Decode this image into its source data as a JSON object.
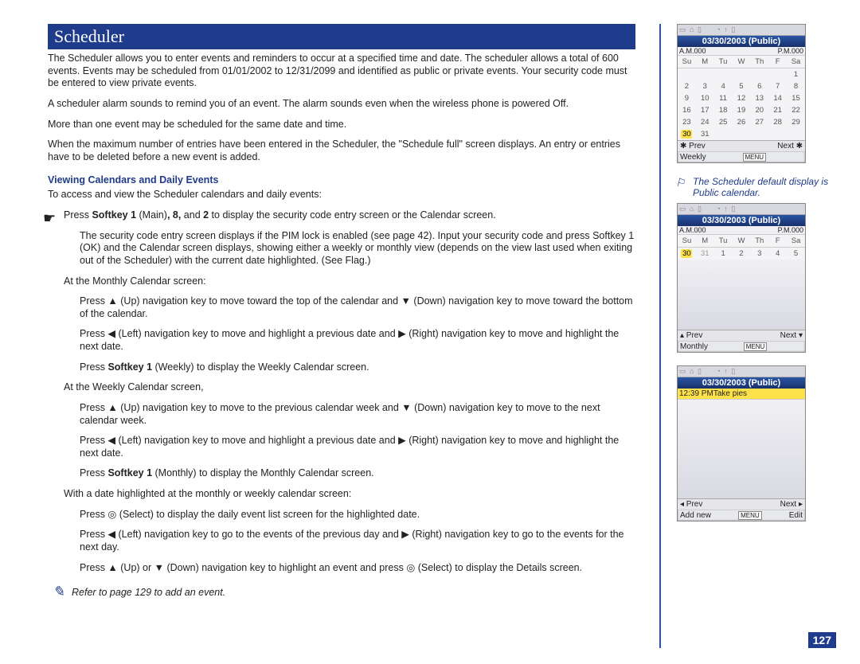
{
  "page_number": "127",
  "title": "Scheduler",
  "intro": [
    "The Scheduler allows you to enter events and reminders to occur at a specified time and date. The scheduler allows a total of 600 events. Events may be scheduled from 01/01/2002 to 12/31/2099 and identified as public or private events. Your security code must be entered to view private events.",
    "A scheduler alarm sounds to remind you of an event. The alarm sounds even when the wireless phone is powered Off.",
    "More than one event may be scheduled for the same date and time.",
    "When the maximum number of entries have been entered in the Scheduler, the \"Schedule full\" screen displays. An entry or entries have to be deleted before a new event is added."
  ],
  "subhead": "Viewing Calendars and Daily Events",
  "subhead_intro": "To access and view the Scheduler calendars and daily events:",
  "step1_a": "Press ",
  "step1_b": "Softkey 1",
  "step1_c": " (Main)",
  "step1_d": ", 8,",
  "step1_e": " and ",
  "step1_f": "2",
  "step1_g": " to display the security code entry screen or the Calendar screen.",
  "step1_sub": "The security code entry screen displays if the PIM lock is enabled (see page 42). Input your security code and press Softkey 1 (OK) and the Calendar screen displays, showing either a weekly or monthly view (depends on the view last used when exiting out of the Scheduler) with the current date highlighted. (See Flag.)",
  "monthly_head": "At the Monthly Calendar screen:",
  "monthly_1": "Press ▲ (Up) navigation key to move toward the top of the calendar and ▼ (Down) navigation key to move toward the bottom of the calendar.",
  "monthly_2": "Press ◀ (Left) navigation key to move and highlight a previous date and ▶ (Right) navigation key to move and highlight the next date.",
  "monthly_3_a": "Press ",
  "monthly_3_b": "Softkey 1",
  "monthly_3_c": " (Weekly) to display the Weekly Calendar screen.",
  "weekly_head": "At the Weekly Calendar screen,",
  "weekly_1": "Press ▲ (Up) navigation key to move to the previous calendar week and ▼ (Down) navigation key to move to the next calendar week.",
  "weekly_2": "Press ◀ (Left) navigation key to move and highlight a previous date and ▶ (Right) navigation key to move and highlight the next date.",
  "weekly_3_a": "Press ",
  "weekly_3_b": "Softkey 1",
  "weekly_3_c": " (Monthly) to display the Monthly Calendar screen.",
  "daily_head": "With a date highlighted at the monthly or weekly calendar screen:",
  "daily_1": "Press ◎ (Select) to display the daily event list screen for the highlighted date.",
  "daily_2": "Press ◀ (Left) navigation key to go to the events of the previous day and ▶ (Right) navigation key to go to the events for the next day.",
  "daily_3": "Press ▲ (Up) or ▼ (Down) navigation key to highlight an event and press ◎ (Select) to display the Details screen.",
  "tip": "Refer to page 129 to add an event.",
  "flag_note": "The Scheduler default display is Public calendar.",
  "screens": {
    "date_header": "03/30/2003 (Public)",
    "am": "A.M.000",
    "pm": "P.M.000",
    "dow": [
      "Su",
      "M",
      "Tu",
      "W",
      "Th",
      "F",
      "Sa"
    ],
    "prev": "✱ Prev",
    "next": "Next ✱",
    "weekly_label": "Weekly",
    "monthly_label": "Monthly",
    "menu": "MENU",
    "week_days": [
      "Su",
      "M",
      "Tu",
      "W",
      "Th",
      "F",
      "Sa"
    ],
    "week_nums": [
      "30",
      "31",
      "1",
      "2",
      "3",
      "4",
      "5"
    ],
    "wk_prev": "▴ Prev",
    "wk_next": "Next ▾",
    "ev_time": "12:39 PM",
    "ev_text": "Take pies",
    "ev_prev": "◂ Prev",
    "ev_next": "Next ▸",
    "addnew": "Add new",
    "edit": "Edit"
  }
}
